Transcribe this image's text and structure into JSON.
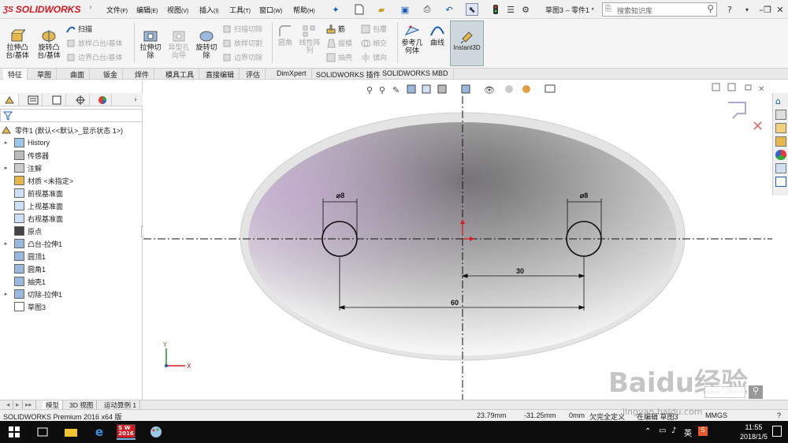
{
  "app": {
    "logo": "SOLIDWORKS",
    "window_title": "草图3 – 零件1 *",
    "search_placeholder": "搜索知识库"
  },
  "menus": [
    {
      "label": "文件",
      "key": "(F)"
    },
    {
      "label": "编辑",
      "key": "(E)"
    },
    {
      "label": "视图",
      "key": "(V)"
    },
    {
      "label": "插入",
      "key": "(I)"
    },
    {
      "label": "工具",
      "key": "(T)"
    },
    {
      "label": "窗口",
      "key": "(W)"
    },
    {
      "label": "帮助",
      "key": "(H)"
    }
  ],
  "ribbon": {
    "extrude_boss": "拉伸凸\n台/基体",
    "revolve_boss": "旋转凸\n台/基体",
    "sweep": "扫描",
    "loft_boss": "放样凸台/基体",
    "boundary_boss": "边界凸台/基体",
    "extrude_cut": "拉伸切\n除",
    "hole_wizard": "异型孔\n向导",
    "revolve_cut": "旋转切\n除",
    "swept_cut": "扫描切除",
    "lofted_cut": "放样切割",
    "boundary_cut": "边界切除",
    "fillet": "圆角",
    "linear_pattern": "线性阵\n列",
    "rib": "筋",
    "draft": "拔模",
    "shell": "抽壳",
    "wrap": "包覆",
    "intersect": "相交",
    "mirror": "镜向",
    "reference_geometry": "参考几\n何体",
    "curves": "曲线",
    "instant3d": "Instant3D"
  },
  "tabs": [
    "特征",
    "草图",
    "曲面",
    "钣金",
    "焊件",
    "模具工具",
    "直接编辑",
    "评估",
    "DimXpert",
    "SOLIDWORKS 插件",
    "SOLIDWORKS MBD"
  ],
  "tree": {
    "root": "零件1  (默认<<默认>_显示状态 1>)",
    "items": [
      {
        "label": "History",
        "expand": true
      },
      {
        "label": "传感器",
        "expand": false
      },
      {
        "label": "注解",
        "expand": true
      },
      {
        "label": "材质 <未指定>",
        "expand": false
      },
      {
        "label": "前视基准面",
        "expand": false
      },
      {
        "label": "上视基准面",
        "expand": false
      },
      {
        "label": "右视基准面",
        "expand": false
      },
      {
        "label": "原点",
        "expand": false
      },
      {
        "label": "凸台-拉伸1",
        "expand": true
      },
      {
        "label": "圆顶1",
        "expand": false
      },
      {
        "label": "圆角1",
        "expand": false
      },
      {
        "label": "抽壳1",
        "expand": false
      },
      {
        "label": "切除-拉伸1",
        "expand": true
      },
      {
        "label": "草图3",
        "expand": false
      }
    ]
  },
  "sketch": {
    "dim_left_diameter": "⌀8",
    "dim_right_diameter": "⌀8",
    "dim_30": "30",
    "dim_60": "60",
    "triad_y": "Y",
    "triad_x": "X"
  },
  "bottom_tabs": [
    "模型",
    "3D 视图",
    "运动算例 1"
  ],
  "status": {
    "product": "SOLIDWORKS Premium 2016 x64 版",
    "x": "23.79mm",
    "y": "-31.25mm",
    "z": "0mm",
    "state": "欠完全定义",
    "editing": "在编辑 草图3",
    "units": "MMGS"
  },
  "taskbar": {
    "time": "11:55",
    "date": "2018/1/5",
    "ime": "英",
    "sw_label": "S W\n2016"
  },
  "watermark": {
    "brand": "Baidu经验",
    "url": "jingyan.baidu.com"
  },
  "colors": {
    "accent_red": "#d71920",
    "dim_blue": "#1a5cb5",
    "ribbon_active": "#cfd8dc"
  }
}
